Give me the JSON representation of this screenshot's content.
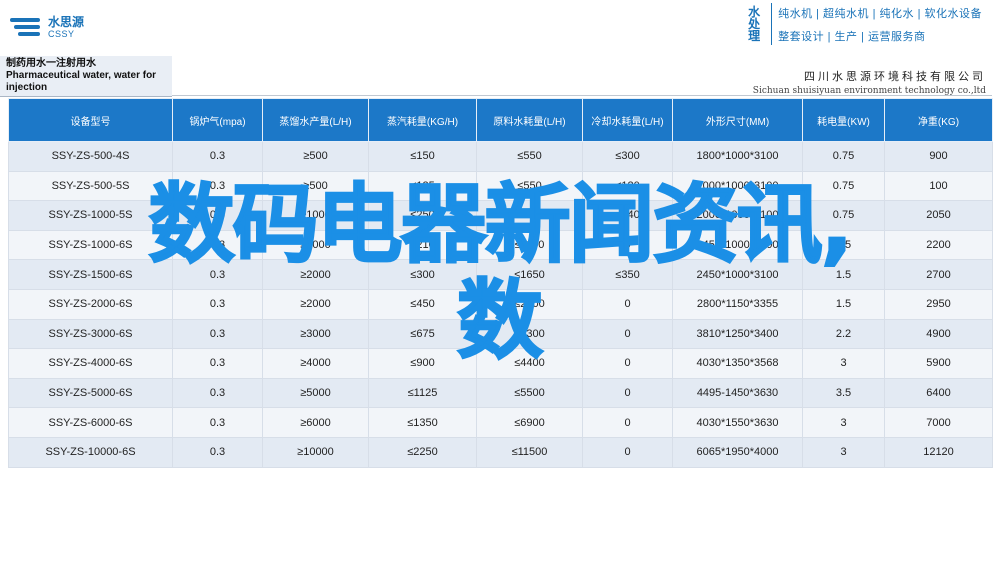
{
  "header": {
    "logo_cn": "水思源",
    "logo_en": "CSSY",
    "brand_vertical": "水处理",
    "brand_line1": "纯水机 | 超纯水机 | 纯化水 | 软化水设备",
    "brand_line2": "整套设计 | 生产 | 运营服务商",
    "company_cn": "四川水思源环境科技有限公司",
    "company_en": "Sichuan shuisiyuan environment technology co.,ltd"
  },
  "doc_title": {
    "cn": "制药用水一注射用水",
    "en_line1": "Pharmaceutical water, water for",
    "en_line2": "injection"
  },
  "table": {
    "headers": [
      "设备型号",
      "锅炉气(mpa)",
      "蒸馏水产量(L/H)",
      "蒸汽耗量(KG/H)",
      "原料水耗量(L/H)",
      "冷却水耗量(L/H)",
      "外形尺寸(MM)",
      "耗电量(KW)",
      "净重(KG)"
    ],
    "rows": [
      [
        "SSY-ZS-500-4S",
        "0.3",
        "≥500",
        "≤150",
        "≤550",
        "≤300",
        "1800*1000*3100",
        "0.75",
        "900"
      ],
      [
        "SSY-ZS-500-5S",
        "0.3",
        "≥500",
        "≤125",
        "≤550",
        "≤120",
        "2000*1000*3100",
        "0.75",
        "100"
      ],
      [
        "SSY-ZS-1000-5S",
        "0.3",
        "≥1000",
        "≤250",
        "≤1100",
        "≤240",
        "2000*1000*3100",
        "0.75",
        "2050"
      ],
      [
        "SSY-ZS-1000-6S",
        "0.3",
        "≥1000",
        "≤210",
        "≤1100",
        "0",
        "2450*1000*3100",
        "1.5",
        "2200"
      ],
      [
        "SSY-ZS-1500-6S",
        "0.3",
        "≥2000",
        "≤300",
        "≤1650",
        "≤350",
        "2450*1000*3100",
        "1.5",
        "2700"
      ],
      [
        "SSY-ZS-2000-6S",
        "0.3",
        "≥2000",
        "≤450",
        "≤2200",
        "0",
        "2800*1150*3355",
        "1.5",
        "2950"
      ],
      [
        "SSY-ZS-3000-6S",
        "0.3",
        "≥3000",
        "≤675",
        "≤3300",
        "0",
        "3810*1250*3400",
        "2.2",
        "4900"
      ],
      [
        "SSY-ZS-4000-6S",
        "0.3",
        "≥4000",
        "≤900",
        "≤4400",
        "0",
        "4030*1350*3568",
        "3",
        "5900"
      ],
      [
        "SSY-ZS-5000-6S",
        "0.3",
        "≥5000",
        "≤1125",
        "≤5500",
        "0",
        "4495-1450*3630",
        "3.5",
        "6400"
      ],
      [
        "SSY-ZS-6000-6S",
        "0.3",
        "≥6000",
        "≤1350",
        "≤6900",
        "0",
        "4030*1550*3630",
        "3",
        "7000"
      ],
      [
        "SSY-ZS-10000-6S",
        "0.3",
        "≥10000",
        "≤2250",
        "≤11500",
        "0",
        "6065*1950*4000",
        "3",
        "12120"
      ]
    ]
  },
  "overlay": {
    "line1": "数码电器新闻资讯,",
    "line2": "数"
  }
}
